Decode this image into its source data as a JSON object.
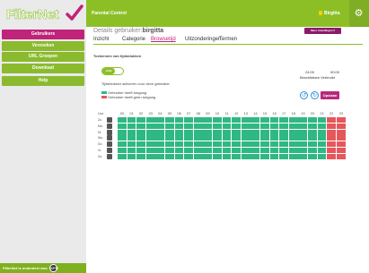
{
  "app": {
    "logo_text_a": "Filter",
    "logo_text_b": "Net"
  },
  "sidebar": {
    "items": [
      {
        "label": "Gebruikers",
        "active": true
      },
      {
        "label": "Verzoeken",
        "active": false
      },
      {
        "label": "URL Groepen",
        "active": false
      },
      {
        "label": "Download",
        "active": false
      },
      {
        "label": "Help",
        "active": false
      }
    ],
    "footer": {
      "text": "FilterNet is onderdeel van:",
      "badge": "KPN"
    }
  },
  "topbar": {
    "title": "Parental Control",
    "user": "Birgitta",
    "gear_icon": "gear-icon"
  },
  "details": {
    "label": "Details gebruiker:",
    "username": "birgitta",
    "more_settings": "Meer instellingen"
  },
  "tabs": [
    {
      "label": "Inzicht",
      "active": false
    },
    {
      "label": "Categorie",
      "active": false
    },
    {
      "label": "Browsetijd",
      "active": true
    },
    {
      "label": "Uitzonderingen",
      "active": false
    },
    {
      "label": "Termen",
      "active": false
    }
  ],
  "browsetijd": {
    "section_title": "Toekennen van tijdsblokken",
    "toggle_label": "AAN",
    "toggle_on": true,
    "toggle_description": "Tijdsblokken activeren voor deze gebruiker",
    "time_from": "24:00",
    "time_to": "00:00",
    "remaining_label": "Beschikbare Verbruikt",
    "legend_allowed": "Gebruiker heeft toegang",
    "legend_denied": "Gebruiker heeft geen toegang",
    "save_label": "Opslaan",
    "hour_label": "Uur",
    "hours": [
      "00",
      "01",
      "02",
      "03",
      "04",
      "05",
      "06",
      "07",
      "08",
      "09",
      "10",
      "11",
      "12",
      "13",
      "14",
      "15",
      "16",
      "17",
      "18",
      "19",
      "20",
      "21",
      "22",
      "23"
    ],
    "days": [
      "Zo.",
      "Ma.",
      "Di.",
      "Wo.",
      "Do.",
      "Vr.",
      "Za."
    ],
    "denied_hours": [
      "22",
      "23"
    ],
    "colors": {
      "allowed": "#2fb883",
      "denied": "#e5575b",
      "accent": "#c0237a",
      "brand": "#8cbf26"
    }
  }
}
